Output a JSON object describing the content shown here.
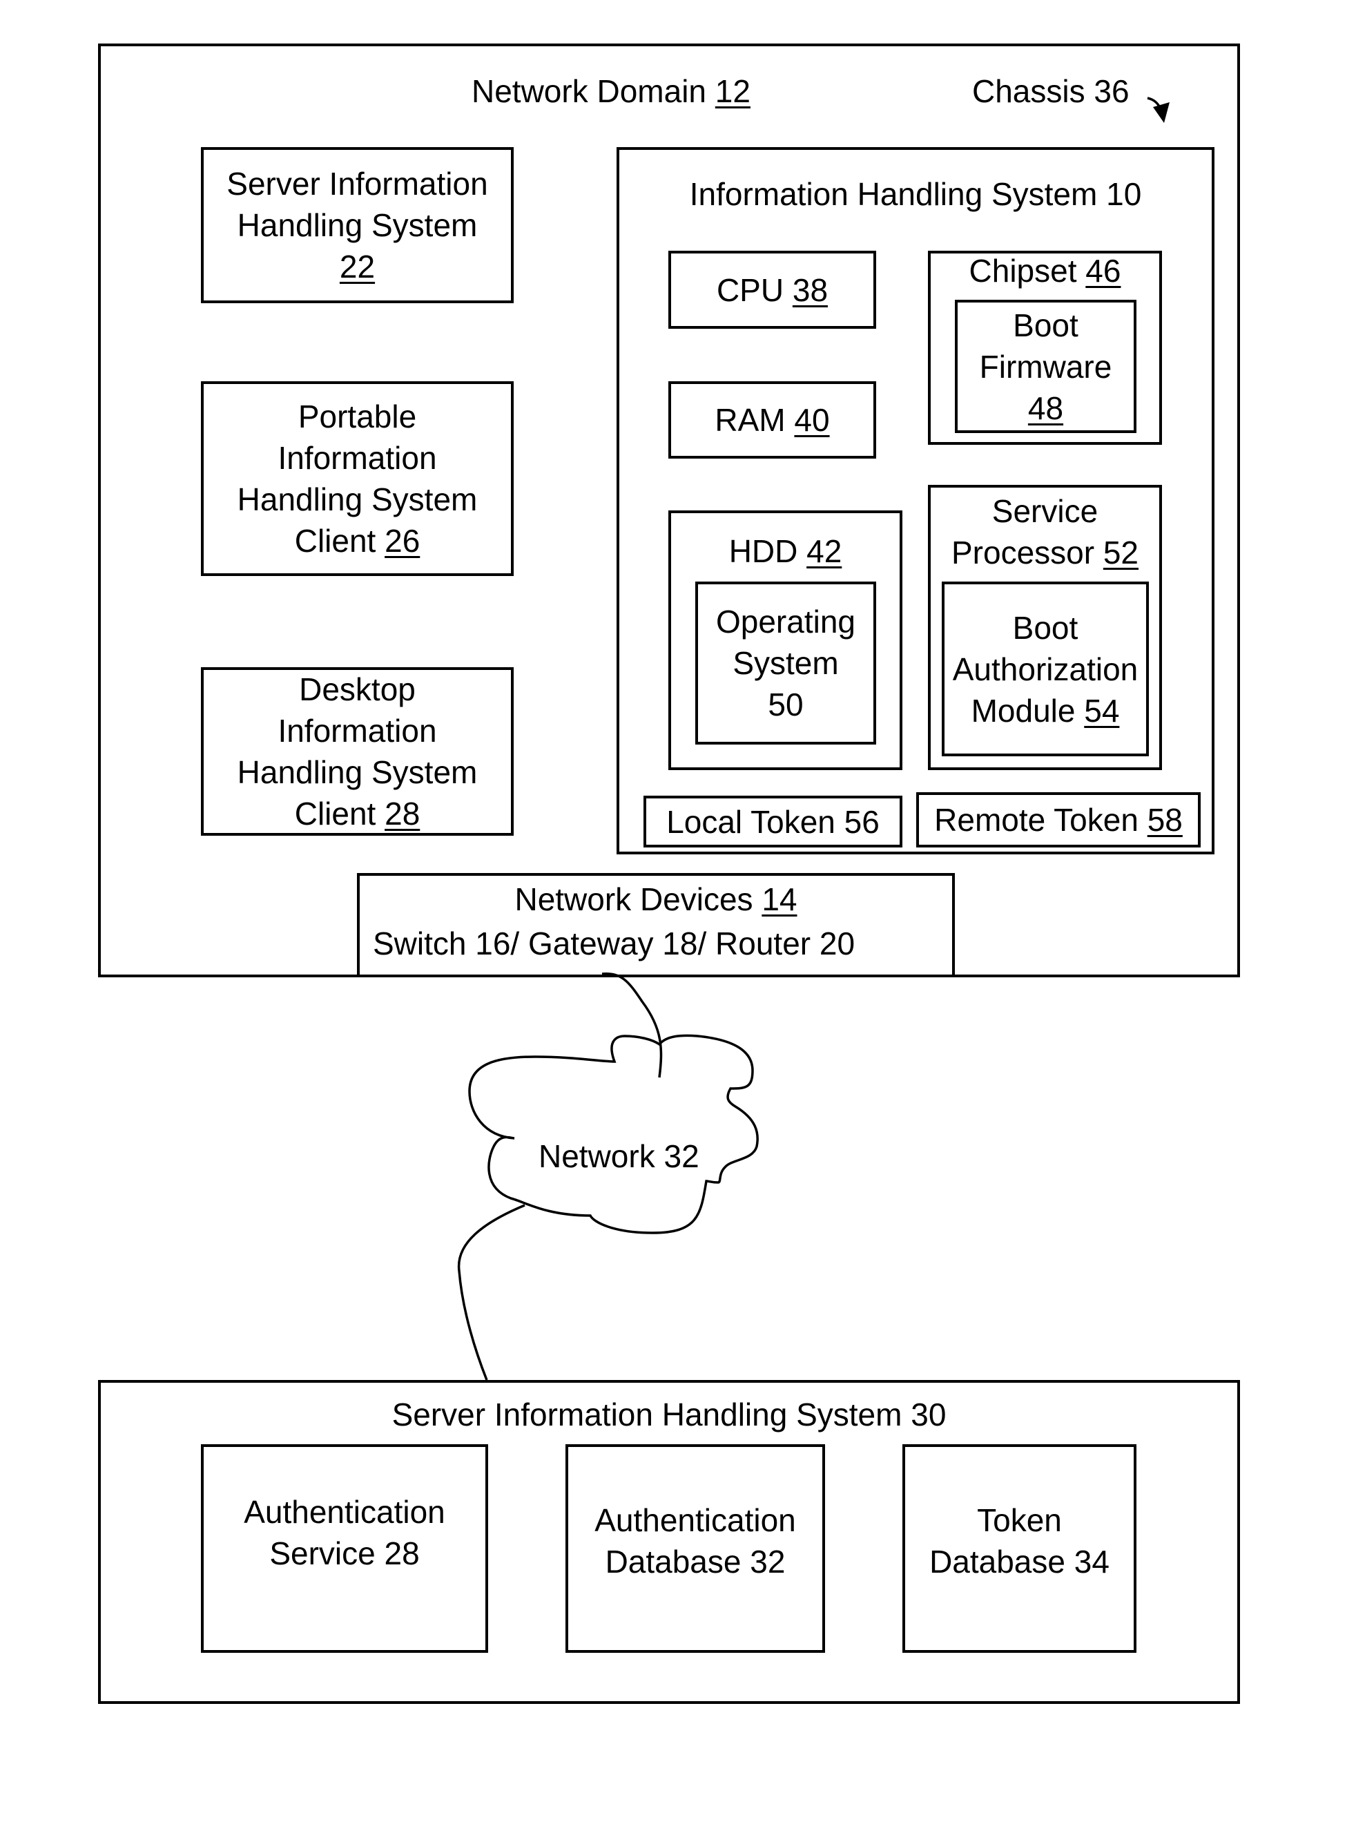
{
  "network_domain": {
    "label": "Network Domain",
    "ref": "12"
  },
  "chassis": {
    "label": "Chassis 36"
  },
  "server_22": {
    "line1": "Server Information",
    "line2": "Handling System",
    "ref": "22"
  },
  "portable_26": {
    "line1": "Portable",
    "line2": "Information",
    "line3": "Handling System",
    "line4": "Client",
    "ref": "26"
  },
  "desktop_28": {
    "line1": "Desktop",
    "line2": "Information",
    "line3": "Handling System",
    "line4": "Client",
    "ref": "28"
  },
  "ihs_10": {
    "title": "Information Handling System 10"
  },
  "cpu": {
    "label": "CPU",
    "ref": "38"
  },
  "ram": {
    "label": "RAM",
    "ref": "40"
  },
  "chipset": {
    "label": "Chipset",
    "ref": "46"
  },
  "boot_firmware": {
    "line1": "Boot",
    "line2": "Firmware",
    "ref": "48"
  },
  "hdd": {
    "label": "HDD",
    "ref": "42"
  },
  "os": {
    "line1": "Operating",
    "line2": "System",
    "line3": "50"
  },
  "service_processor": {
    "line1": "Service",
    "line2": "Processor",
    "ref": "52"
  },
  "bam": {
    "line1": "Boot",
    "line2": "Authorization",
    "line3": "Module",
    "ref": "54"
  },
  "local_token": {
    "label": "Local Token 56"
  },
  "remote_token": {
    "label": "Remote Token",
    "ref": "58"
  },
  "network_devices": {
    "line1": "Network Devices",
    "ref": "14",
    "line2": "Switch 16/ Gateway 18/ Router 20"
  },
  "network": {
    "label": "Network 32"
  },
  "server_30": {
    "title": "Server Information Handling System 30"
  },
  "auth_service": {
    "line1": "Authentication",
    "line2": "Service 28"
  },
  "auth_db": {
    "line1": "Authentication",
    "line2": "Database 32"
  },
  "token_db": {
    "line1": "Token",
    "line2": "Database 34"
  }
}
